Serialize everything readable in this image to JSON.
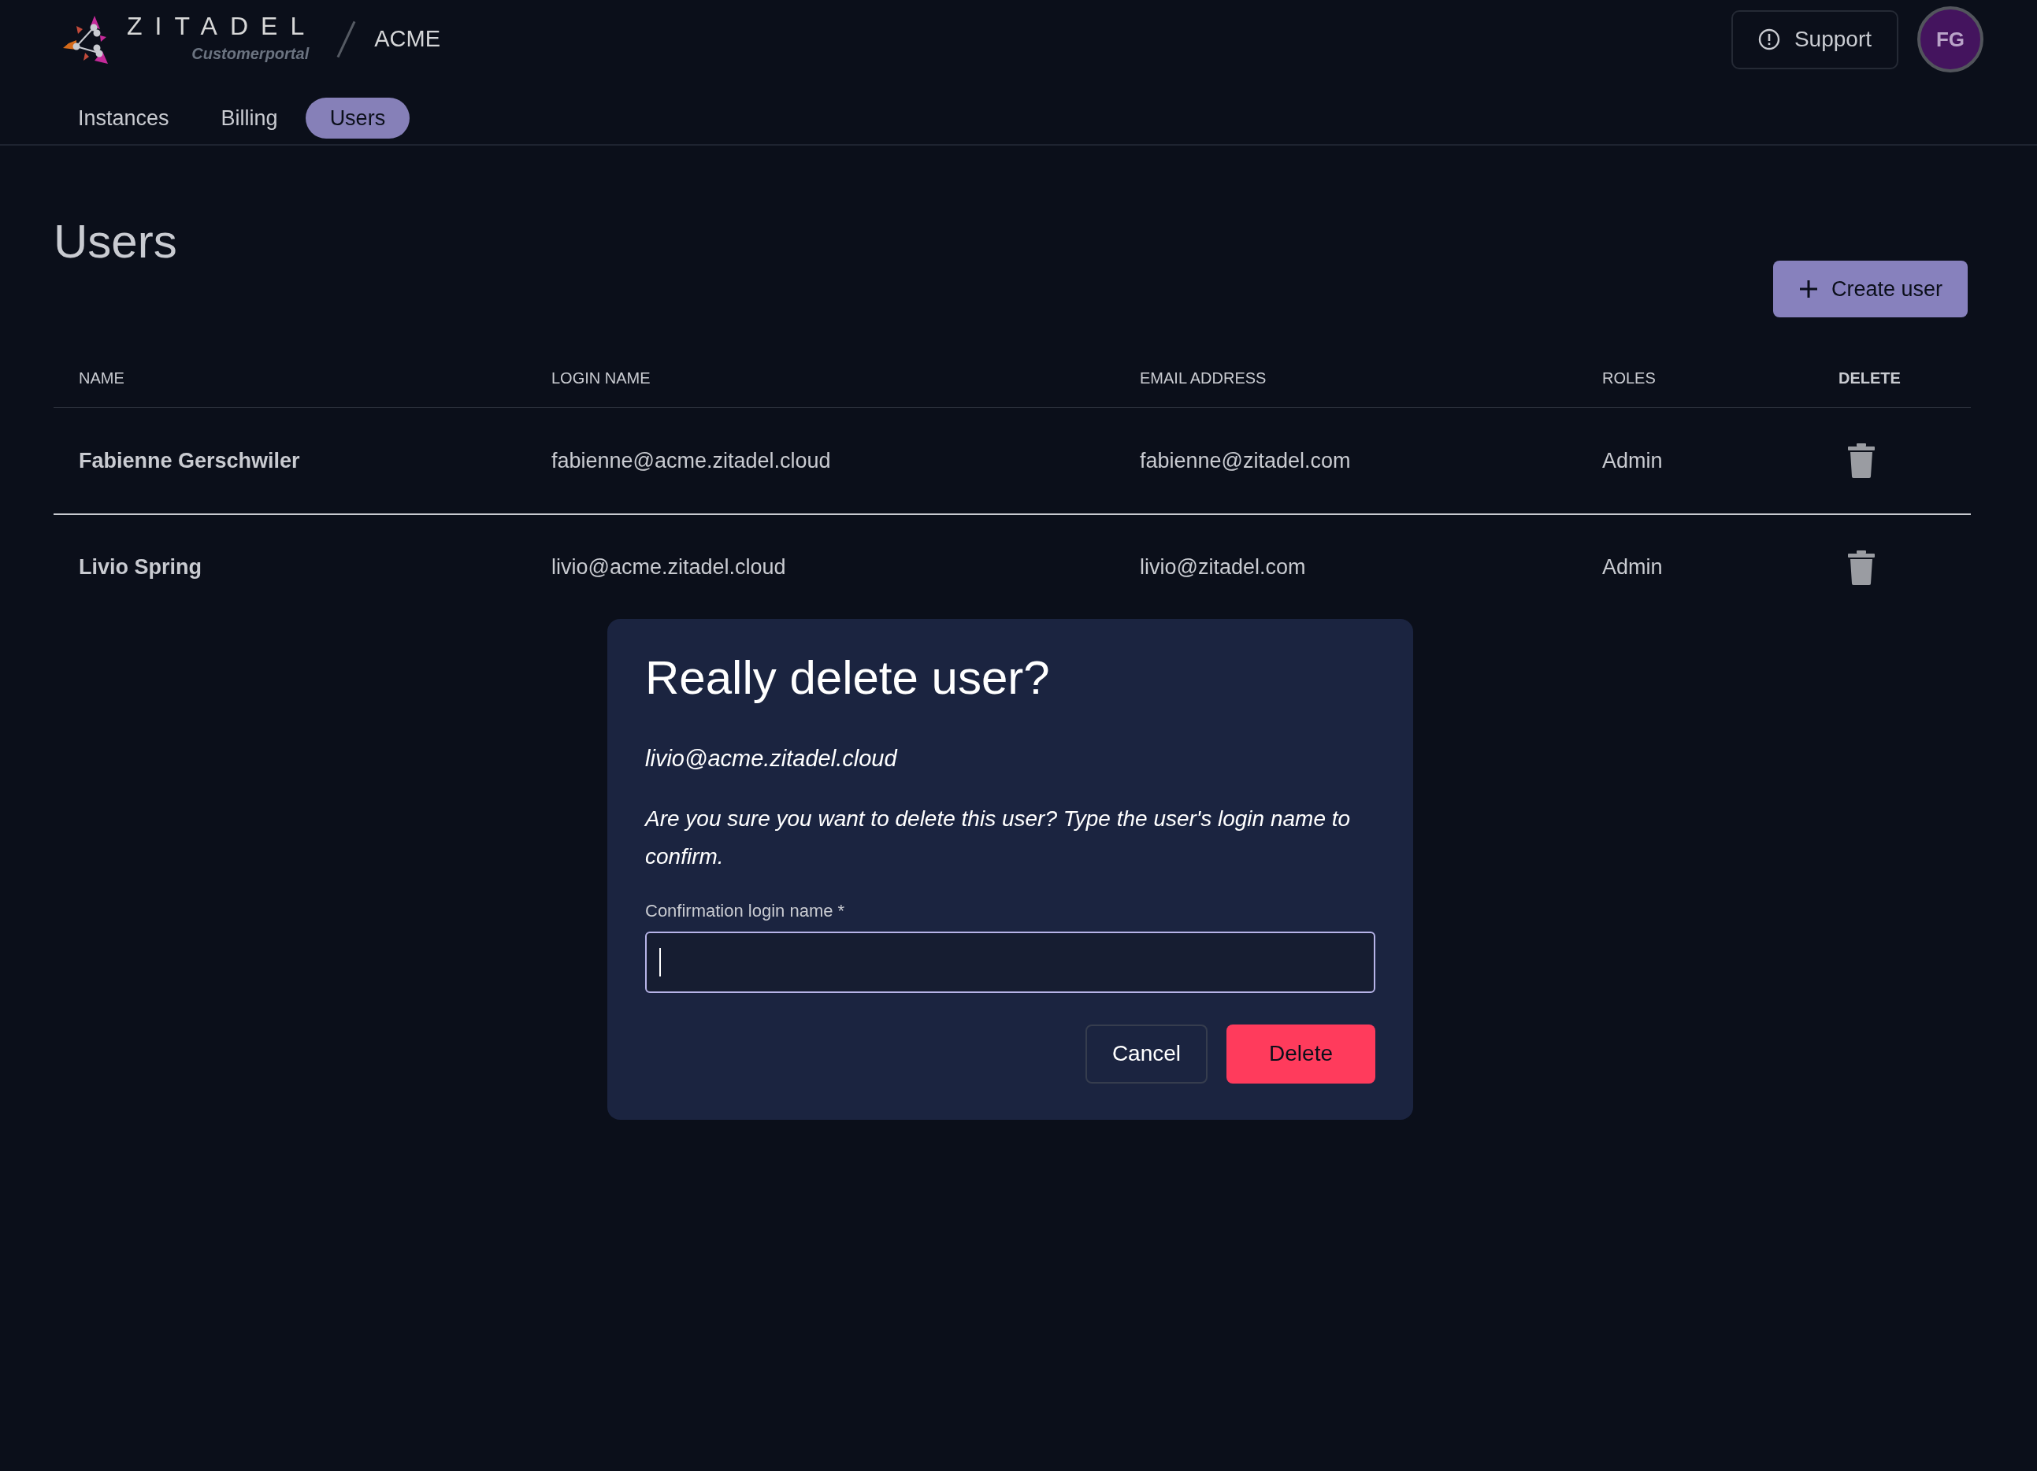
{
  "header": {
    "logo_word": "ZITADEL",
    "logo_subtitle": "Customerportal",
    "organization": "ACME",
    "support_button": "Support",
    "avatar_initials": "FG"
  },
  "tabs": [
    {
      "label": "Instances",
      "selected": false
    },
    {
      "label": "Billing",
      "selected": false
    },
    {
      "label": "Users",
      "selected": true
    }
  ],
  "page_title": "Users",
  "create_button": "Create user",
  "table": {
    "columns": [
      {
        "label": "NAME",
        "bold": false
      },
      {
        "label": "LOGIN NAME",
        "bold": false
      },
      {
        "label": "EMAIL ADDRESS",
        "bold": false
      },
      {
        "label": "ROLES",
        "bold": false
      },
      {
        "label": "DELETE",
        "bold": true
      }
    ],
    "rows": [
      {
        "name": "Fabienne Gerschwiler",
        "login_name": "fabienne@acme.zitadel.cloud",
        "email": "fabienne@zitadel.com",
        "role": "Admin"
      },
      {
        "name": "Livio Spring",
        "login_name": "livio@acme.zitadel.cloud",
        "email": "livio@zitadel.com",
        "role": "Admin"
      }
    ]
  },
  "dialog": {
    "title": "Really delete user?",
    "login_name": "livio@acme.zitadel.cloud",
    "message": "Are you sure you want to delete this user? Type the user's login name to confirm.",
    "field_label": "Confirmation login name *",
    "field_focused": true,
    "buttons": [
      {
        "label": "Cancel",
        "kind": "secondary"
      },
      {
        "label": "Delete",
        "kind": "danger"
      }
    ]
  }
}
